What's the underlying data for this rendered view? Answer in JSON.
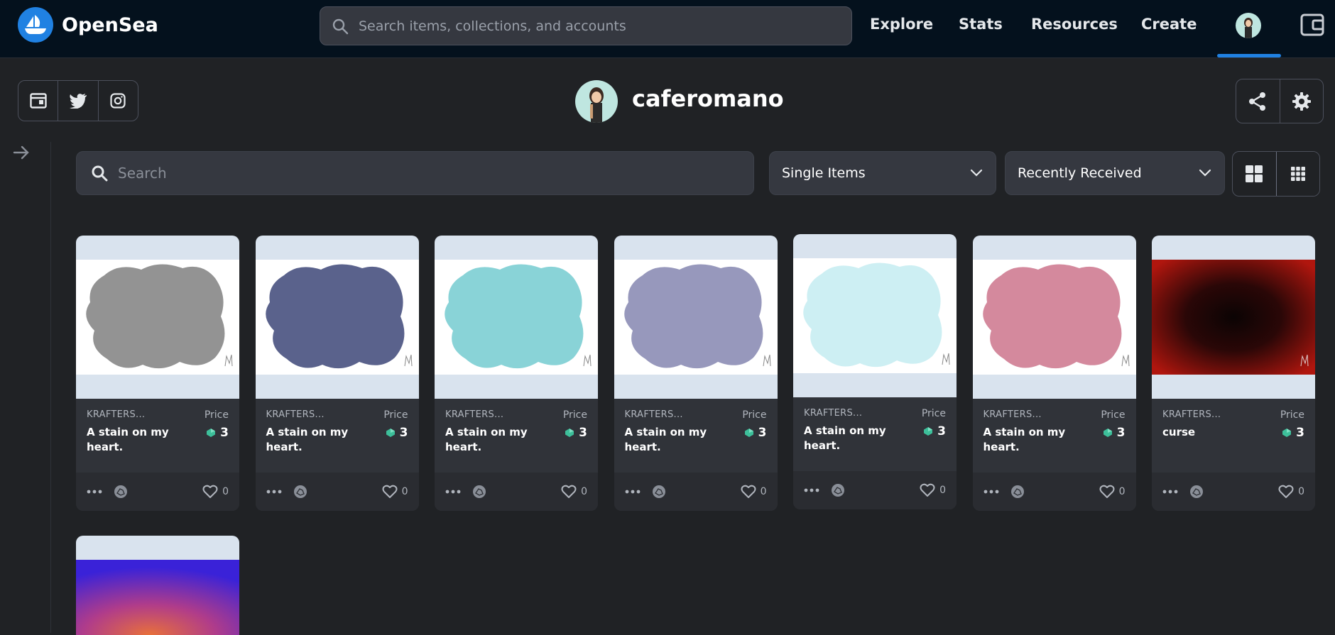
{
  "nav": {
    "brand": "OpenSea",
    "search_placeholder": "Search items, collections, and accounts",
    "links": [
      "Explore",
      "Stats",
      "Resources",
      "Create"
    ]
  },
  "profile": {
    "username": "caferomano"
  },
  "filters": {
    "search_placeholder": "Search",
    "type_select": "Single Items",
    "sort_select": "Recently Received"
  },
  "colors": {
    "accent": "#2081e2",
    "nav_bg": "#04111d",
    "page_bg": "#202225",
    "card_bg": "#303339"
  },
  "cards": [
    {
      "collection": "KRAFTERS...",
      "title": "A stain on my heart.",
      "price_label": "Price",
      "price": "3",
      "likes": "0",
      "stain": "#8a8a8a",
      "variant": "stain"
    },
    {
      "collection": "KRAFTERS...",
      "title": "A stain on my heart.",
      "price_label": "Price",
      "price": "3",
      "likes": "0",
      "stain": "#4c5582",
      "variant": "stain"
    },
    {
      "collection": "KRAFTERS...",
      "title": "A stain on my heart.",
      "price_label": "Price",
      "price": "3",
      "likes": "0",
      "stain": "#7fcfd4",
      "variant": "stain"
    },
    {
      "collection": "KRAFTERS...",
      "title": "A stain on my heart.",
      "price_label": "Price",
      "price": "3",
      "likes": "0",
      "stain": "#8e8fb6",
      "variant": "stain"
    },
    {
      "collection": "KRAFTERS...",
      "title": "A stain on my heart.",
      "price_label": "Price",
      "price": "3",
      "likes": "0",
      "stain": "#c9eef2",
      "variant": "stain"
    },
    {
      "collection": "KRAFTERS...",
      "title": "A stain on my heart.",
      "price_label": "Price",
      "price": "3",
      "likes": "0",
      "stain": "#d07f95",
      "variant": "stain"
    },
    {
      "collection": "KRAFTERS...",
      "title": "curse",
      "price_label": "Price",
      "price": "3",
      "likes": "0",
      "stain": "#1a0505",
      "variant": "curse"
    }
  ]
}
